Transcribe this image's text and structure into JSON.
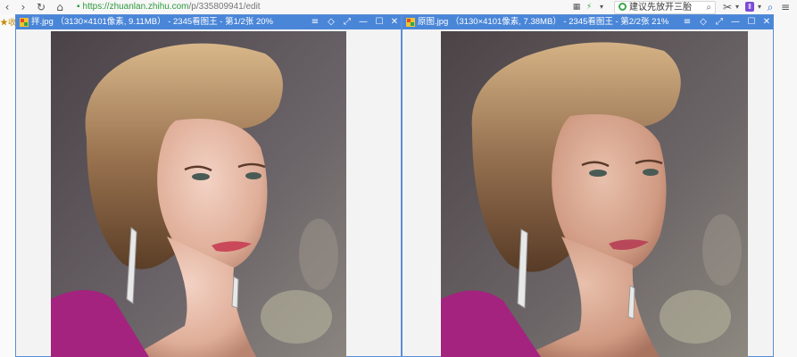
{
  "browser": {
    "url_host": "zhuanlan.zhihu.com",
    "url_path": "/p/335809941/edit",
    "url_scheme": "https://",
    "search_text": "建议先放开三胎",
    "favorites_label": "收",
    "icons": {
      "back": "back-icon",
      "forward": "forward-icon",
      "reload": "reload-icon",
      "home": "home-icon",
      "lock": "lock-icon",
      "scissors": "scissors-icon",
      "search": "search-icon"
    }
  },
  "left_viewer": {
    "title": "拌.jpg （3130×4101像素, 9.11MB） - 2345看图王 - 第1/2张 20%"
  },
  "right_viewer": {
    "title": "原图.jpg （3130×4101像素, 7.38MB） - 2345看图王 - 第2/2张 21%"
  },
  "viewer_controls": {
    "menu": "≡",
    "theme": "◇",
    "fullscreen": "⤢",
    "minimize": "—",
    "maximize": "☐",
    "close": "✕"
  },
  "colors": {
    "titlebar": "#4a86d8",
    "url_host": "#2e9a3e",
    "dress": "#a3237f"
  }
}
